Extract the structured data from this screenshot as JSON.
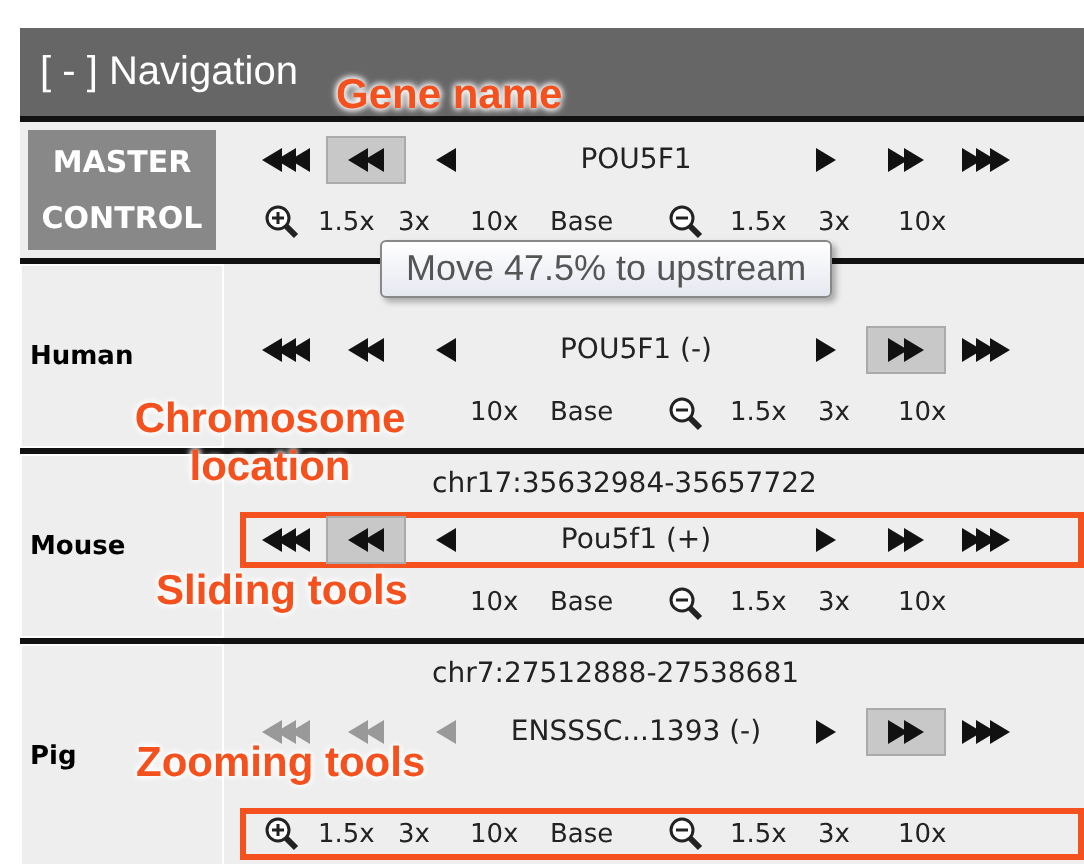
{
  "panel": {
    "title": "[ - ] Navigation"
  },
  "rows": [
    {
      "label": "MASTER CONTROL",
      "kind": "master",
      "arrows": [
        {
          "kind": "triple-left",
          "pressed": false,
          "disabled": false
        },
        {
          "kind": "double-left",
          "pressed": true,
          "disabled": false
        },
        {
          "kind": "single-left",
          "pressed": false,
          "disabled": false
        },
        {
          "kind": "single-right",
          "pressed": false,
          "disabled": false
        },
        {
          "kind": "double-right",
          "pressed": false,
          "disabled": false
        },
        {
          "kind": "triple-right",
          "pressed": false,
          "disabled": false
        }
      ],
      "gene": "POU5F1",
      "zoom": [
        {
          "kind": "zoom-in-icon"
        },
        {
          "kind": "label",
          "text": "1.5x"
        },
        {
          "kind": "label",
          "text": "3x"
        },
        {
          "kind": "label",
          "text": "10x"
        },
        {
          "kind": "label",
          "text": "Base"
        },
        {
          "kind": "zoom-out-icon"
        },
        {
          "kind": "label",
          "text": "1.5x"
        },
        {
          "kind": "label",
          "text": "3x"
        },
        {
          "kind": "label",
          "text": "10x"
        }
      ]
    },
    {
      "label": "Human",
      "kind": "species",
      "arrows": [
        {
          "kind": "triple-left",
          "pressed": false,
          "disabled": false
        },
        {
          "kind": "double-left",
          "pressed": false,
          "disabled": false
        },
        {
          "kind": "single-left",
          "pressed": false,
          "disabled": false
        },
        {
          "kind": "single-right",
          "pressed": false,
          "disabled": false
        },
        {
          "kind": "double-right",
          "pressed": true,
          "disabled": false
        },
        {
          "kind": "triple-right",
          "pressed": false,
          "disabled": false
        }
      ],
      "gene": "POU5F1 (-)",
      "zoom": [
        {
          "kind": "label",
          "text": "10x"
        },
        {
          "kind": "label",
          "text": "Base"
        },
        {
          "kind": "zoom-out-icon"
        },
        {
          "kind": "label",
          "text": "1.5x"
        },
        {
          "kind": "label",
          "text": "3x"
        },
        {
          "kind": "label",
          "text": "10x"
        }
      ]
    },
    {
      "label": "Mouse",
      "kind": "species",
      "location": "chr17:35632984-35657722",
      "arrows": [
        {
          "kind": "triple-left",
          "pressed": false,
          "disabled": false
        },
        {
          "kind": "double-left",
          "pressed": true,
          "disabled": false
        },
        {
          "kind": "single-left",
          "pressed": false,
          "disabled": false
        },
        {
          "kind": "single-right",
          "pressed": false,
          "disabled": false
        },
        {
          "kind": "double-right",
          "pressed": false,
          "disabled": false
        },
        {
          "kind": "triple-right",
          "pressed": false,
          "disabled": false
        }
      ],
      "gene": "Pou5f1 (+)",
      "slider_highlighted": true,
      "zoom": [
        {
          "kind": "label",
          "text": "10x"
        },
        {
          "kind": "label",
          "text": "Base"
        },
        {
          "kind": "zoom-out-icon"
        },
        {
          "kind": "label",
          "text": "1.5x"
        },
        {
          "kind": "label",
          "text": "3x"
        },
        {
          "kind": "label",
          "text": "10x"
        }
      ]
    },
    {
      "label": "Pig",
      "kind": "species",
      "location": "chr7:27512888-27538681",
      "arrows": [
        {
          "kind": "triple-left",
          "pressed": false,
          "disabled": true
        },
        {
          "kind": "double-left",
          "pressed": false,
          "disabled": true
        },
        {
          "kind": "single-left",
          "pressed": false,
          "disabled": true
        },
        {
          "kind": "single-right",
          "pressed": false,
          "disabled": false
        },
        {
          "kind": "double-right",
          "pressed": true,
          "disabled": false
        },
        {
          "kind": "triple-right",
          "pressed": false,
          "disabled": false
        }
      ],
      "gene": "ENSSSC...1393 (-)",
      "zoom_highlighted": true,
      "zoom": [
        {
          "kind": "zoom-in-icon"
        },
        {
          "kind": "label",
          "text": "1.5x"
        },
        {
          "kind": "label",
          "text": "3x"
        },
        {
          "kind": "label",
          "text": "10x"
        },
        {
          "kind": "label",
          "text": "Base"
        },
        {
          "kind": "zoom-out-icon"
        },
        {
          "kind": "label",
          "text": "1.5x"
        },
        {
          "kind": "label",
          "text": "3x"
        },
        {
          "kind": "label",
          "text": "10x"
        }
      ]
    }
  ],
  "tooltip": "Move 47.5% to upstream",
  "annotations": [
    {
      "text": "Gene name",
      "kind": "gene"
    },
    {
      "text": "Chromosome location",
      "kind": "location"
    },
    {
      "text": "Sliding tools",
      "kind": "sliding"
    },
    {
      "text": "Zooming tools",
      "kind": "zooming"
    }
  ]
}
